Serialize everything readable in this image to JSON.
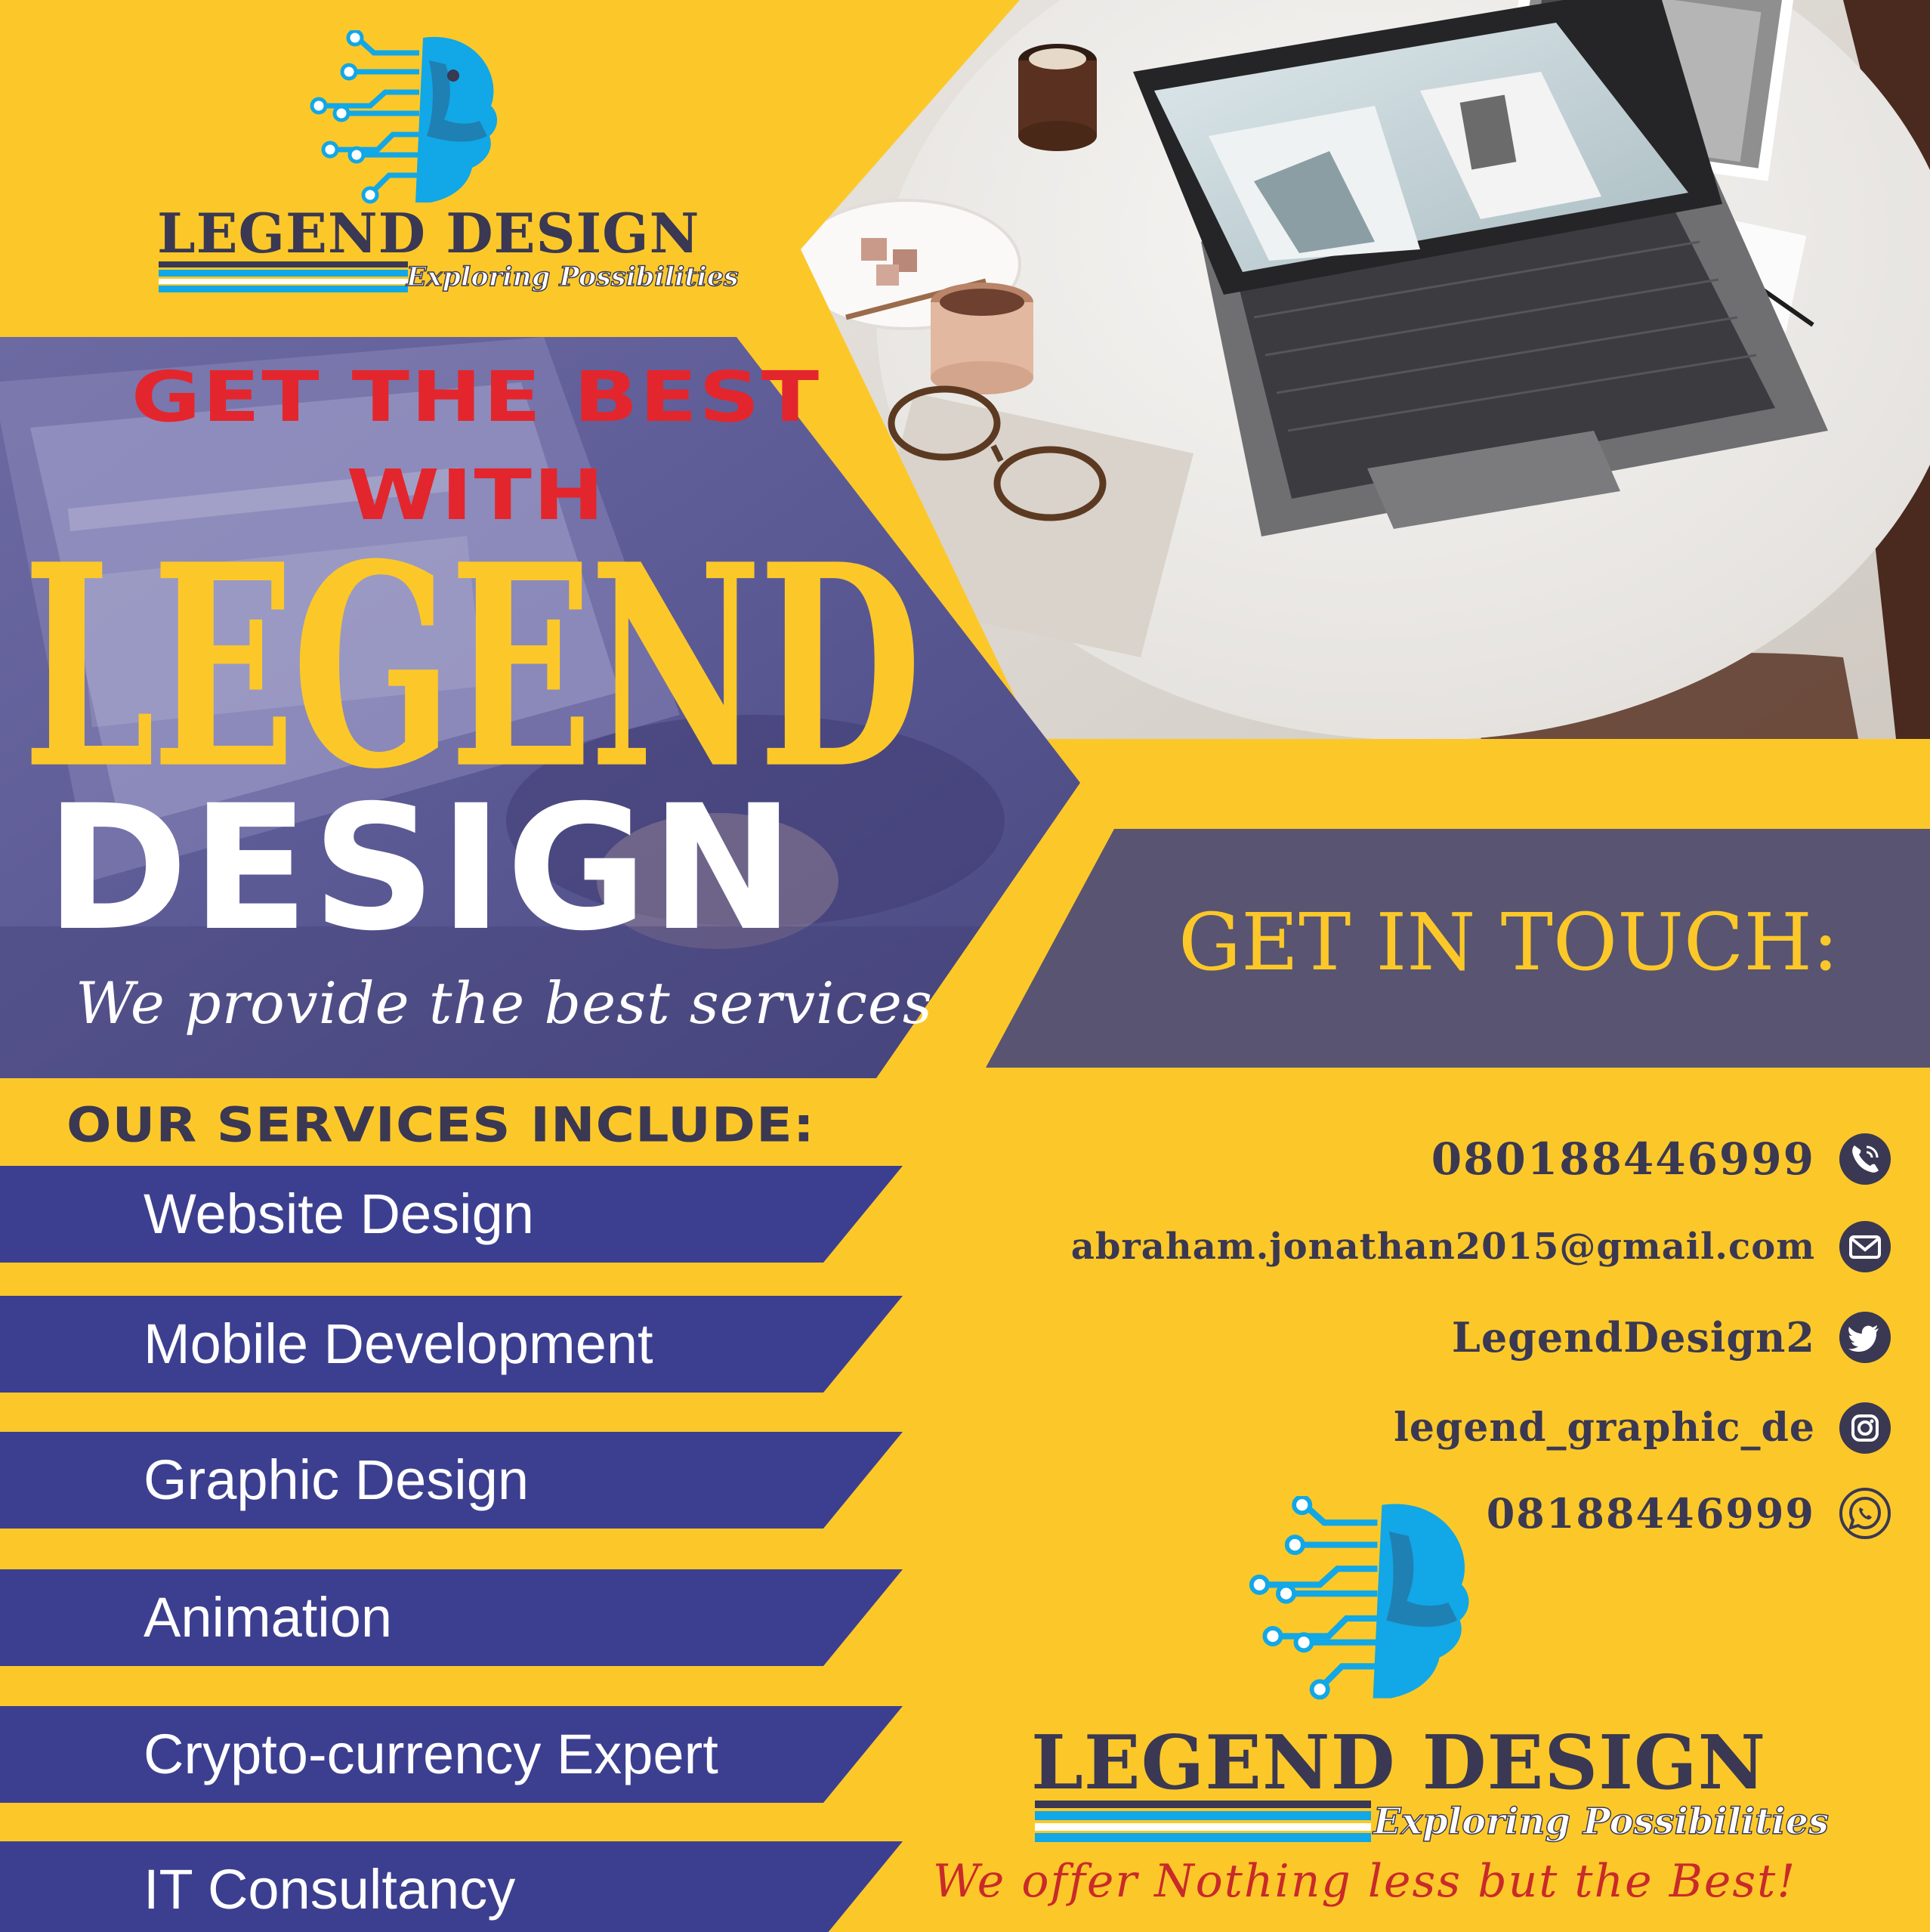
{
  "brand": {
    "name": "LEGEND DESIGN",
    "tagline": "Exploring Possibilities"
  },
  "hero": {
    "line1": "GET THE BEST",
    "line2": "WITH",
    "line3": "LEGEND",
    "line4": "DESIGN",
    "tagline": "We provide the best services"
  },
  "services": {
    "heading": "OUR SERVICES INCLUDE:",
    "items": [
      "Website Design",
      "Mobile Development",
      "Graphic Design",
      "Animation",
      "Crypto-currency Expert",
      "IT Consultancy"
    ]
  },
  "contact": {
    "heading": "GET IN TOUCH:",
    "phone": "080188446999",
    "email": "abraham.jonathan2015@gmail.com",
    "twitter": "LegendDesign2",
    "instagram": "legend_graphic_de",
    "whatsapp": "08188446999"
  },
  "slogan": "We offer Nothing less but the Best!",
  "colors": {
    "background": "#fcc829",
    "navy": "#3a3852",
    "service_bar": "#3c3f8f",
    "touch_box": "#585471",
    "hero_red": "#e3262d",
    "logo_blue": "#12a7e6"
  },
  "icons": [
    "phone-icon",
    "email-icon",
    "twitter-icon",
    "instagram-icon",
    "whatsapp-icon"
  ]
}
